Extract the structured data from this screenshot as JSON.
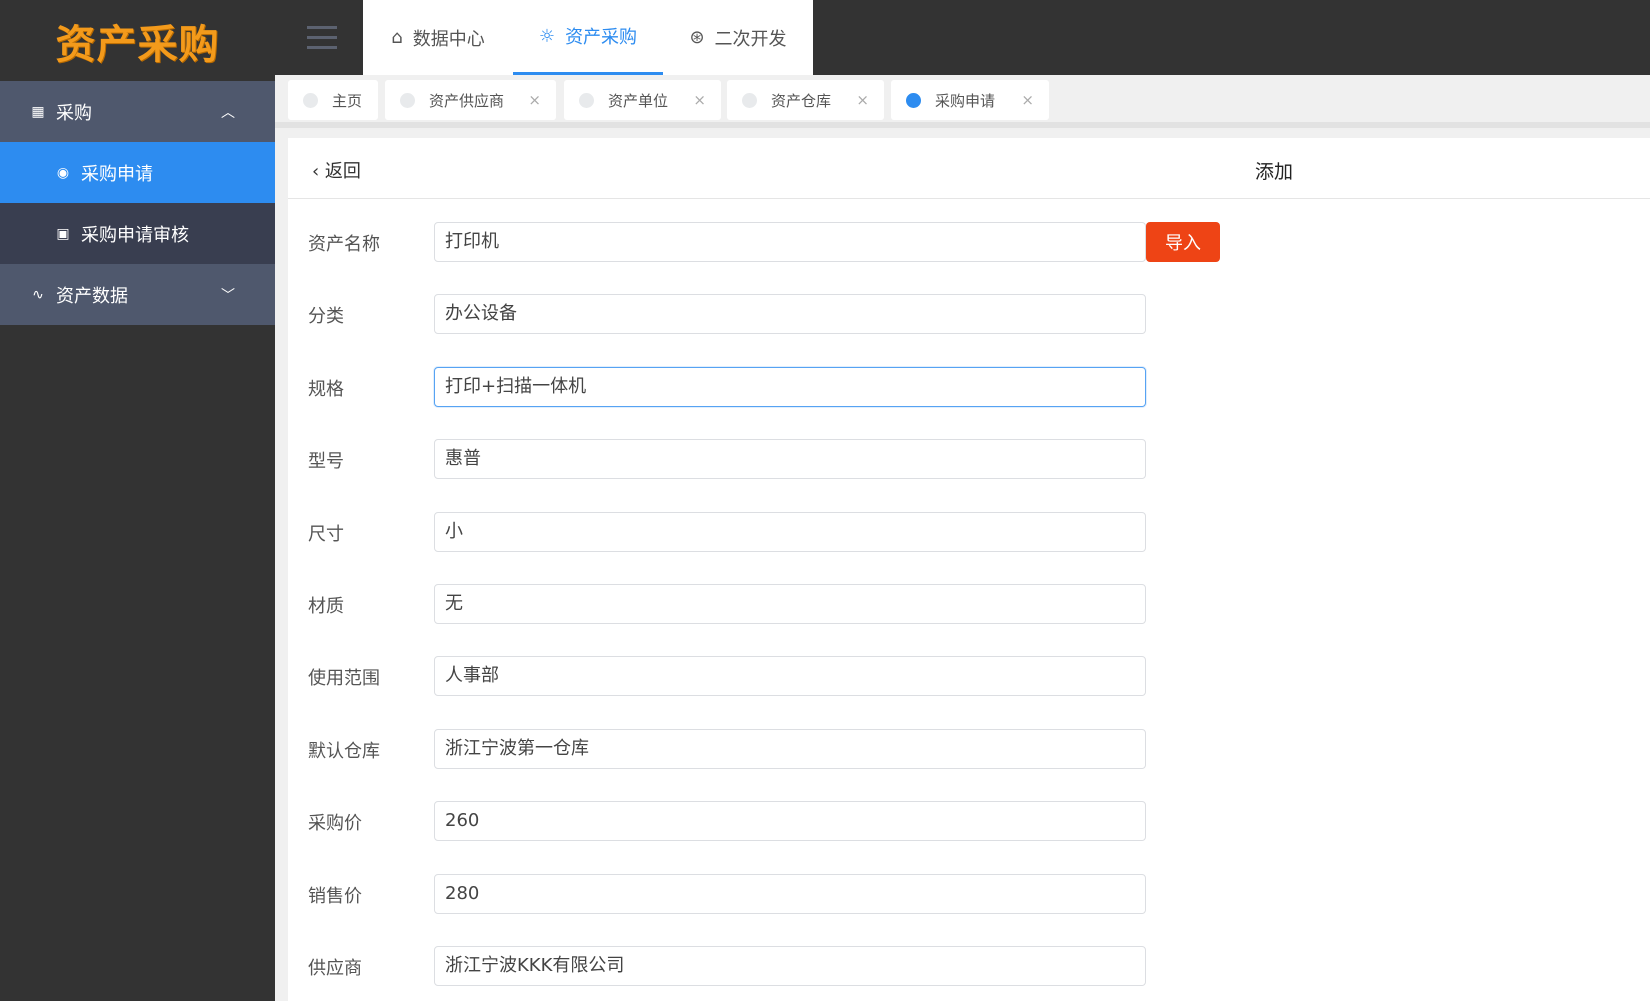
{
  "logo": "资产采购",
  "sidebar": {
    "items": [
      {
        "label": "采购",
        "icon": "grid-icon",
        "chev": "⌃"
      },
      {
        "label": "采购申请",
        "icon": "fingerprint-icon"
      },
      {
        "label": "采购申请审核",
        "icon": "box-icon"
      },
      {
        "label": "资产数据",
        "icon": "pulse-icon",
        "chev": "⌄"
      }
    ]
  },
  "topnav": [
    {
      "label": "数据中心",
      "icon": "⌂"
    },
    {
      "label": "资产采购",
      "icon": "☼"
    },
    {
      "label": "二次开发",
      "icon": "⊛"
    }
  ],
  "tabs": [
    {
      "label": "主页"
    },
    {
      "label": "资产供应商",
      "close": "×"
    },
    {
      "label": "资产单位",
      "close": "×"
    },
    {
      "label": "资产仓库",
      "close": "×"
    },
    {
      "label": "采购申请",
      "close": "×"
    }
  ],
  "card": {
    "back": "‹ 返回",
    "title": "添加",
    "import": "导入"
  },
  "form": [
    {
      "label": "资产名称",
      "value": "打印机"
    },
    {
      "label": "分类",
      "value": "办公设备"
    },
    {
      "label": "规格",
      "value": "打印+扫描一体机"
    },
    {
      "label": "型号",
      "value": "惠普"
    },
    {
      "label": "尺寸",
      "value": "小"
    },
    {
      "label": "材质",
      "value": "无"
    },
    {
      "label": "使用范围",
      "value": "人事部"
    },
    {
      "label": "默认仓库",
      "value": "浙江宁波第一仓库"
    },
    {
      "label": "采购价",
      "value": "260"
    },
    {
      "label": "销售价",
      "value": "280"
    },
    {
      "label": "供应商",
      "value": "浙江宁波KKK有限公司"
    }
  ],
  "colors": {
    "accent": "#2d8cf0",
    "import": "#ee4415",
    "logo": "#f39a1b"
  }
}
